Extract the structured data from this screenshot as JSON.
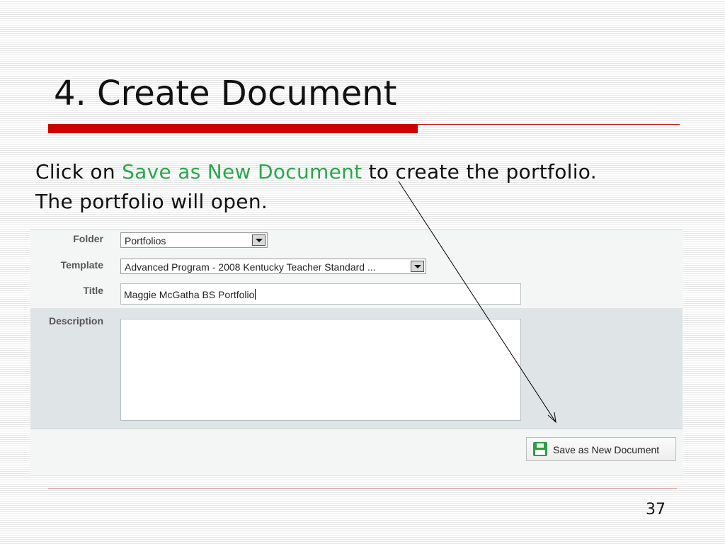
{
  "slide": {
    "title": "4. Create Document",
    "instruction_before": "Click on ",
    "instruction_highlight": "Save as New Document",
    "instruction_after": " to create the portfolio.",
    "instruction_line2": "The portfolio will open.",
    "page_number": "37"
  },
  "form": {
    "folder_label": "Folder",
    "folder_value": "Portfolios",
    "template_label": "Template",
    "template_value": "Advanced Program - 2008 Kentucky Teacher Standard ...",
    "title_label": "Title",
    "title_value": "Maggie McGatha BS Portfolio",
    "description_label": "Description",
    "description_value": "",
    "save_button_label": "Save as New Document"
  },
  "colors": {
    "title_rule": "#cc0000",
    "highlight_text": "#2aa84a",
    "save_icon": "#2e9e44"
  },
  "icons": {
    "select_arrow": "chevron-down-icon",
    "save": "floppy-disk-icon"
  }
}
